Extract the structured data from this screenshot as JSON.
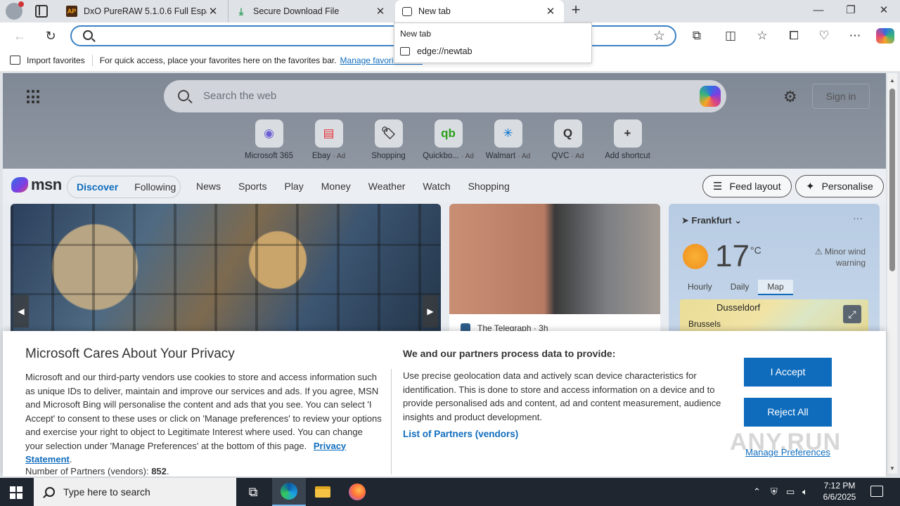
{
  "browser": {
    "tabs": [
      {
        "title": "DxO PureRAW 5.1.0.6 Full Español",
        "favicon_text": "AP"
      },
      {
        "title": "Secure Download File",
        "favicon_text": "⤓"
      },
      {
        "title": "New tab",
        "favicon_text": ""
      }
    ],
    "new_tab_glyph": "+",
    "window_controls": {
      "minimize": "—",
      "maximize": "❐",
      "close": "✕"
    },
    "address": {
      "value": "",
      "placeholder": ""
    },
    "suggestion": {
      "label": "New tab",
      "url": "edge://newtab"
    },
    "favorites_bar": {
      "import_label": "Import favorites",
      "hint": "For quick access, place your favorites here on the favorites bar.",
      "manage_link": "Manage favorites now"
    }
  },
  "newtab": {
    "search_placeholder": "Search the web",
    "sign_in": "Sign in",
    "shortcuts": [
      {
        "label": "Microsoft 365",
        "ad": "",
        "glyph": "◉",
        "color": "#6b5fd3"
      },
      {
        "label": "Ebay",
        "ad": "· Ad",
        "glyph": "▤",
        "color": "#e53238"
      },
      {
        "label": "Shopping",
        "ad": "",
        "glyph": "🏷",
        "color": "#333333"
      },
      {
        "label": "Quickbo...",
        "ad": "· Ad",
        "glyph": "qb",
        "color": "#2ca01c"
      },
      {
        "label": "Walmart",
        "ad": "· Ad",
        "glyph": "✳",
        "color": "#0071ce"
      },
      {
        "label": "QVC",
        "ad": "· Ad",
        "glyph": "Q",
        "color": "#333333"
      },
      {
        "label": "Add shortcut",
        "ad": "",
        "glyph": "+",
        "color": "#333333"
      }
    ],
    "msn": {
      "logo": "msn",
      "discover": "Discover",
      "following": "Following",
      "nav": [
        "News",
        "Sports",
        "Play",
        "Money",
        "Weather",
        "Watch",
        "Shopping"
      ],
      "feed_layout": "Feed layout",
      "personalise": "Personalise"
    },
    "news_card": {
      "source": "The Telegraph",
      "age": "· 3h"
    },
    "weather": {
      "location": "Frankfurt",
      "temperature": "17",
      "unit": "°C",
      "warning": "Minor wind warning",
      "tabs": [
        "Hourly",
        "Daily",
        "Map"
      ],
      "selected_tab": "Map",
      "map_cities": [
        "Dusseldorf",
        "Brussels"
      ]
    }
  },
  "consent": {
    "title": "Microsoft Cares About Your Privacy",
    "body": "Microsoft and our third-party vendors use cookies to store and access information such as unique IDs to deliver, maintain and improve our services and ads. If you agree, MSN and Microsoft Bing will personalise the content and ads that you see. You can select 'I Accept' to consent to these uses or click on 'Manage preferences' to review your options and exercise your right to object to Legitimate Interest where used.  You can change your selection under 'Manage Preferences' at the bottom of this page.",
    "privacy_link": "Privacy Statement",
    "partners_label": "Number of Partners (vendors):",
    "partners_count": "852",
    "right_title": "We and our partners process data to provide:",
    "right_body": "Use precise geolocation data and actively scan device characteristics for identification. This is done to store and access information on a device and to provide personalised ads and content, ad and content measurement, audience insights and product development.",
    "vendors_link": "List of Partners (vendors)",
    "accept": "I Accept",
    "reject": "Reject All",
    "manage": "Manage Preferences",
    "watermark": "ANY.RUN"
  },
  "taskbar": {
    "search_placeholder": "Type here to search",
    "time": "7:12 PM",
    "date": "6/6/2025"
  }
}
